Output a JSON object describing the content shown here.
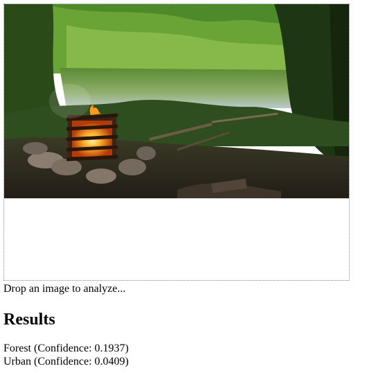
{
  "dropzone": {
    "prompt": "Drop an image to analyze..."
  },
  "results": {
    "heading": "Results",
    "items": [
      {
        "label": "Forest",
        "confidence": "0.1937",
        "text": "Forest (Confidence: 0.1937)"
      },
      {
        "label": "Urban",
        "confidence": "0.0409",
        "text": "Urban (Confidence: 0.0409)"
      }
    ]
  },
  "colors": {
    "border": "#8a8a8a",
    "background": "#ffffff",
    "text": "#000000"
  }
}
